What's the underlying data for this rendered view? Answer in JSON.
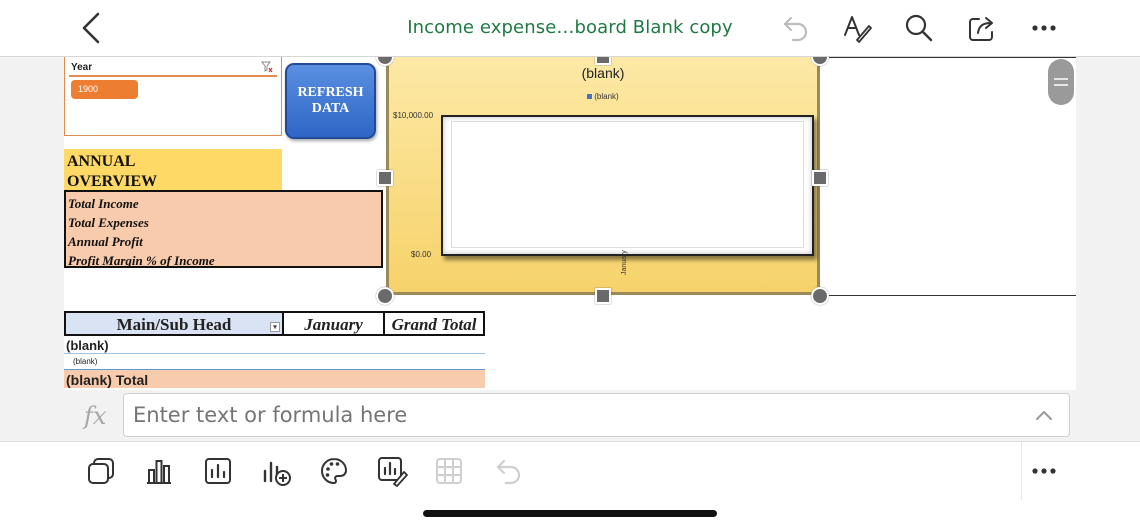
{
  "app": {
    "title": "Income expense…board Blank copy",
    "accent": "#1e7a45"
  },
  "toolbar_top": {
    "icons": [
      "back-chevron-icon",
      "undo-icon",
      "draw-pen-icon",
      "search-icon",
      "share-icon",
      "more-icon"
    ]
  },
  "slicer": {
    "title": "Year",
    "selected": "1900",
    "accent": "#ed7d31"
  },
  "refresh_button": {
    "line1": "REFRESH",
    "line2": "DATA"
  },
  "annual": {
    "heading_line1": "ANNUAL",
    "heading_line2": "OVERVIEW",
    "rows": [
      "Total Income",
      "Total Expenses",
      "Annual Profit",
      "Profit Margin % of Income"
    ]
  },
  "pivot": {
    "headers": [
      "Main/Sub Head",
      "January",
      "Grand Total"
    ],
    "rows": [
      "(blank)",
      "(blank)",
      "(blank) Total"
    ]
  },
  "chart_data": {
    "type": "bar",
    "title": "(blank)",
    "series": [
      {
        "name": "(blank)",
        "values": []
      }
    ],
    "categories": [
      "January"
    ],
    "ytick_labels": [
      "$10,000.00",
      "$0.00"
    ],
    "ylim": [
      0,
      10000
    ],
    "legend": "top",
    "grid": false
  },
  "formula_bar": {
    "fx_label": "fx",
    "placeholder": "Enter text or formula here"
  },
  "toolbar_bottom": {
    "icons": [
      "copy-icon",
      "bar-chart-icon",
      "chart-elements-icon",
      "add-chart-icon",
      "palette-icon",
      "edit-chart-icon",
      "table-grid-icon",
      "undo-icon",
      "more-icon"
    ]
  }
}
